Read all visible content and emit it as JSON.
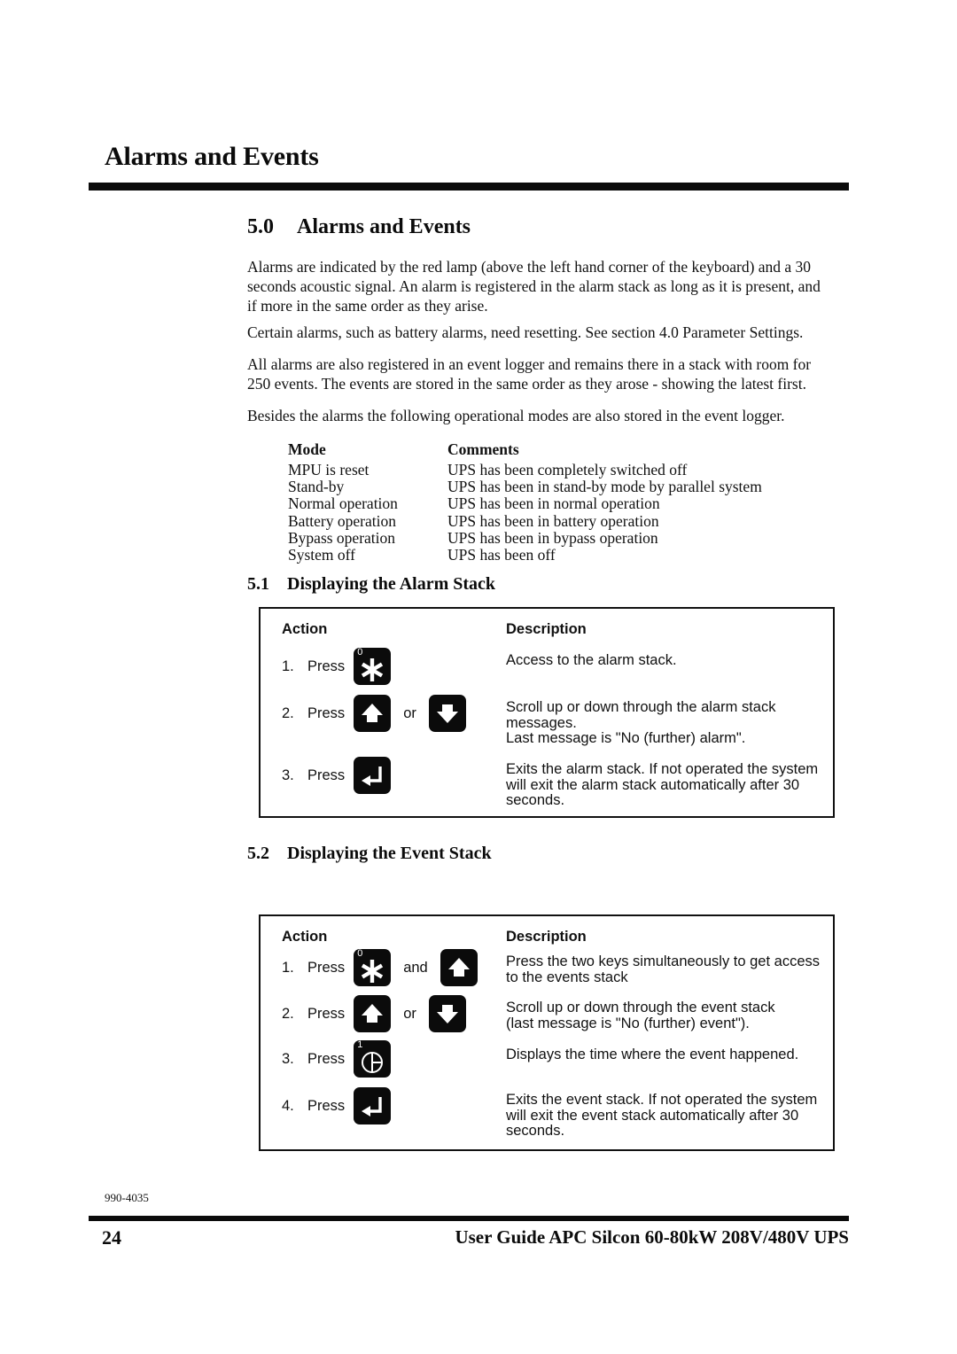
{
  "running_head": "Alarms and Events",
  "section_main": {
    "number": "5.0",
    "title": "Alarms and Events"
  },
  "paragraphs": {
    "p1": "Alarms are indicated by the red lamp (above the left hand corner of the keyboard) and a 30 seconds acoustic signal. An alarm is registered in the alarm stack as long as it is present, and if more in the same order as they arise.",
    "p2": "Certain alarms, such as battery alarms, need resetting. See section 4.0 Parameter Settings.",
    "p3": "All alarms are also registered in an event logger and remains there in a stack with room for 250 events. The events are stored in the same order as they arose - showing the latest first.",
    "p4": "Besides the alarms the following operational modes are also stored in the event logger."
  },
  "modes_table": {
    "headers": [
      "Mode",
      "Comments"
    ],
    "rows": [
      [
        "MPU is reset",
        "UPS has been completely switched off"
      ],
      [
        "Stand-by",
        "UPS has been in stand-by mode by parallel system"
      ],
      [
        "Normal operation",
        "UPS has been in normal operation"
      ],
      [
        "Battery operation",
        "UPS has been in battery operation"
      ],
      [
        "Bypass operation",
        "UPS has been in bypass operation"
      ],
      [
        "System off",
        "UPS has been off"
      ]
    ]
  },
  "section_alarm": {
    "number": "5.1",
    "title": "Displaying the Alarm Stack"
  },
  "alarm_table": {
    "headers": {
      "action": "Action",
      "description": "Description"
    },
    "rows": [
      {
        "index": "1.",
        "press_label": "Press",
        "keys": [
          {
            "icon": "star-key-icon",
            "corner_digit": "0"
          }
        ],
        "conjunction": "",
        "description_lines": [
          "Access to the alarm stack."
        ]
      },
      {
        "index": "2.",
        "press_label": "Press",
        "keys": [
          {
            "icon": "arrow-up-key-icon",
            "corner_digit": ""
          },
          {
            "icon": "arrow-down-key-icon",
            "corner_digit": ""
          }
        ],
        "conjunction": "or",
        "description_lines": [
          "Scroll up or down through the alarm stack",
          "messages.",
          "Last message is \"No (further) alarm\"."
        ]
      },
      {
        "index": "3.",
        "press_label": "Press",
        "keys": [
          {
            "icon": "enter-key-icon",
            "corner_digit": ""
          }
        ],
        "conjunction": "",
        "description_lines": [
          "Exits the alarm stack. If not operated the system",
          "will exit the alarm stack automatically after 30",
          "seconds."
        ]
      }
    ]
  },
  "section_event": {
    "number": "5.2",
    "title": "Displaying the Event Stack"
  },
  "event_table": {
    "headers": {
      "action": "Action",
      "description": "Description"
    },
    "rows": [
      {
        "index": "1.",
        "press_label": "Press",
        "keys": [
          {
            "icon": "star-key-icon",
            "corner_digit": "0"
          },
          {
            "icon": "arrow-up-key-icon",
            "corner_digit": ""
          }
        ],
        "conjunction": "and",
        "description_lines": [
          "Press the two keys simultaneously to get access",
          "to the events stack"
        ]
      },
      {
        "index": "2.",
        "press_label": "Press",
        "keys": [
          {
            "icon": "arrow-up-key-icon",
            "corner_digit": ""
          },
          {
            "icon": "arrow-down-key-icon",
            "corner_digit": ""
          }
        ],
        "conjunction": "or",
        "description_lines": [
          "Scroll up or down through the event stack",
          "(last message is \"No (further) event\")."
        ]
      },
      {
        "index": "3.",
        "press_label": "Press",
        "keys": [
          {
            "icon": "clock-key-icon",
            "corner_digit": "1"
          }
        ],
        "conjunction": "",
        "description_lines": [
          "Displays the time where the event happened."
        ]
      },
      {
        "index": "4.",
        "press_label": "Press",
        "keys": [
          {
            "icon": "enter-key-icon",
            "corner_digit": ""
          }
        ],
        "conjunction": "",
        "description_lines": [
          "Exits the event stack. If not operated the system",
          "will exit the event stack automatically after 30",
          "seconds."
        ]
      }
    ]
  },
  "footer": {
    "doc_code": "990-4035",
    "page_number": "24",
    "guide_title": "User Guide APC Silcon 60-80kW 208V/480V UPS"
  },
  "colors": {
    "ink": "#0b0b0b",
    "paper": "#ffffff",
    "key_fill": "#0b0b0b",
    "key_glyph": "#ffffff"
  }
}
